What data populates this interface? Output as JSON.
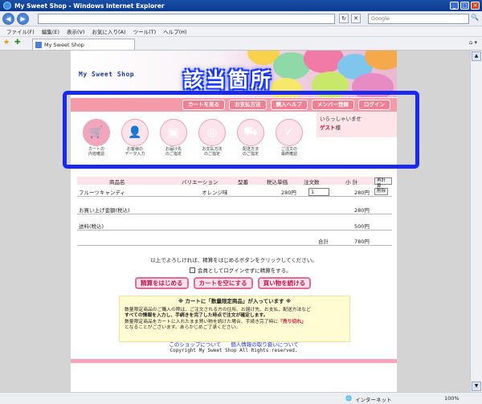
{
  "window": {
    "title": "My Sweet Shop - Windows Internet Explorer",
    "minimize": "_",
    "maximize": "□",
    "close": "✕"
  },
  "address": {
    "url": "",
    "refresh": "↻",
    "stop": "✕",
    "back": "◀",
    "forward": "▶"
  },
  "search": {
    "placeholder": "Google",
    "button": "🔍"
  },
  "menu": [
    "ファイル(F)",
    "編集(E)",
    "表示(V)",
    "お気に入り(A)",
    "ツール(T)",
    "ヘルプ(H)"
  ],
  "tab": {
    "title": "My Sweet Shop",
    "tools": "⌂ ▾"
  },
  "callout": "該当箇所",
  "shop": {
    "title": "My Sweet Shop"
  },
  "nav": [
    "カートを見る",
    "お支払方法",
    "購入ヘルプ",
    "メンバー登録",
    "ログイン"
  ],
  "steps": [
    {
      "label1": "カートの",
      "label2": "内容確認",
      "icon": "cart-icon"
    },
    {
      "label1": "お客様の",
      "label2": "データ入力",
      "icon": "person-icon"
    },
    {
      "label1": "お届け先",
      "label2": "のご指定",
      "icon": "box-icon"
    },
    {
      "label1": "お支払方法",
      "label2": "のご指定",
      "icon": "ring-icon"
    },
    {
      "label1": "配送方法",
      "label2": "のご指定",
      "icon": "truck-icon"
    },
    {
      "label1": "ご注文の",
      "label2": "最終確認",
      "icon": "ok-icon"
    }
  ],
  "welcome": {
    "greeting": "いらっしゃいませ",
    "name": "ゲスト",
    "suffix": "様"
  },
  "cart": {
    "headers": {
      "product": "商品名",
      "variation": "バリエーション",
      "model": "型番",
      "price": "税込単価",
      "qty": "注文数",
      "subtotal": "小 計",
      "update": "再計算"
    },
    "item": {
      "name": "フルーツキャンディ",
      "variation": "オレンジ味",
      "price": "280円",
      "qty": "1",
      "subtotal": "280円",
      "delete": "削除"
    },
    "summary": [
      {
        "label": "お買い上げ金額(税込)",
        "value": "280円"
      },
      {
        "label": "送料(税込)",
        "value": "500円"
      },
      {
        "label": "合計",
        "value": "780円"
      }
    ]
  },
  "message": "以上でよろしければ、精算をはじめるボタンをクリックしてください。",
  "guest_checkbox": "会員としてログインせずに精算をする。",
  "actions": [
    "精算をはじめる",
    "カートを空にする",
    "買い物を続ける"
  ],
  "notice": {
    "title": "※ カートに「数量限定商品」が入っています ※",
    "line1": "数量限定商品のご購入の際は、ご注文される方の住所、お届け先、お支払、配送方法など",
    "line2": "すべての情報を入力し、手続きを完了した時点で注文が確定します。",
    "line3": "数量限定商品をカートに入れたまま買い物を続けた場合、手続き完了時に",
    "sold_out": "「売り切れ」",
    "line4": "となることがございます。あらかじめご了承ください。"
  },
  "footer": {
    "link1": "このショップについて",
    "link2": "個人情報の取り扱いについて",
    "copyright": "Copyright My Sweet Shop All Rights reserved."
  },
  "status": {
    "zone": "インターネット",
    "zoom": "100%"
  }
}
